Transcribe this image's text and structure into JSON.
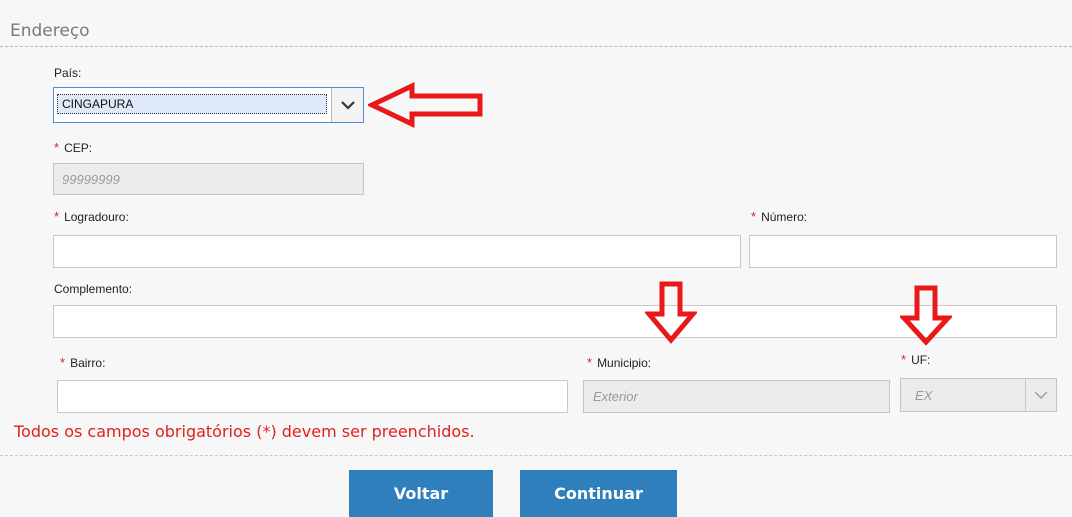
{
  "section": {
    "title": "Endereço"
  },
  "pais": {
    "label": "País:",
    "value": "CINGAPURA"
  },
  "cep": {
    "required_mark": "*",
    "label": "CEP:",
    "placeholder": "99999999"
  },
  "logradouro": {
    "required_mark": "*",
    "label": "Logradouro:",
    "value": ""
  },
  "numero": {
    "required_mark": "*",
    "label": "Número:",
    "value": ""
  },
  "complemento": {
    "label": "Complemento:",
    "value": ""
  },
  "bairro": {
    "required_mark": "*",
    "label": "Bairro:",
    "value": ""
  },
  "municipio": {
    "required_mark": "*",
    "label": "Municipio:",
    "placeholder": "Exterior"
  },
  "uf": {
    "required_mark": "*",
    "label": "UF:",
    "placeholder": "EX"
  },
  "validation": {
    "message": "Todos os campos obrigatórios (*) devem ser preenchidos."
  },
  "buttons": {
    "back": "Voltar",
    "continue": "Continuar"
  },
  "annotations": {
    "arrow_color": "#e8191a"
  },
  "theme": {
    "primary_button": "#2f7fbd",
    "required_color": "#e02020"
  }
}
